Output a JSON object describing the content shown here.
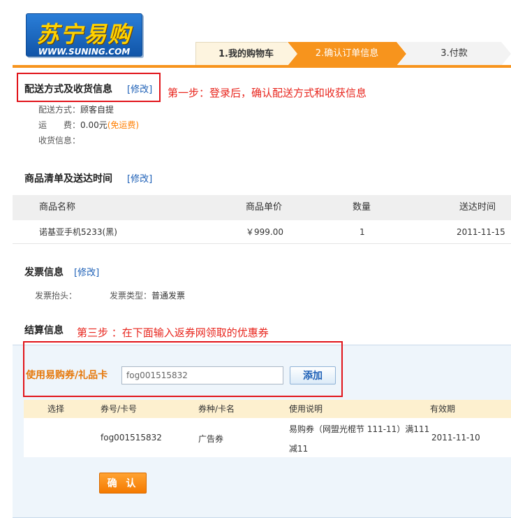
{
  "logo": {
    "brand": "苏宁易购",
    "url": "WWW.SUNING.COM"
  },
  "steps": [
    {
      "label": "1.我的购物车"
    },
    {
      "label": "2.确认订单信息"
    },
    {
      "label": "3.付款"
    }
  ],
  "delivery": {
    "title": "配送方式及收货信息",
    "edit": "[修改]",
    "annotation": "第一步：登录后，确认配送方式和收获信息",
    "method_label": "配送方式：",
    "method_value": "顾客自提",
    "fee_label": "运　　费：",
    "fee_value": "0.00元",
    "fee_note": "(免运费)",
    "address_label": "收货信息："
  },
  "goods": {
    "title": "商品清单及送达时间",
    "edit": "[修改]",
    "columns": [
      "商品名称",
      "商品单价",
      "数量",
      "送达时间"
    ],
    "rows": [
      {
        "name": "诺基亚手机5233(黑)",
        "price": "￥999.00",
        "qty": "1",
        "date": "2011-11-15"
      }
    ]
  },
  "invoice": {
    "title": "发票信息",
    "edit": "[修改]",
    "header_label": "发票抬头：",
    "type_label": "发票类型：",
    "type_value": "普通发票"
  },
  "settlement": {
    "title": "结算信息",
    "annotation": "第三步 ：在下面输入返券网领取的优惠券",
    "coupon_label": "使用易购券/礼品卡",
    "coupon_value": "fog001515832",
    "add_button": "添加",
    "columns": [
      "选择",
      "券号/卡号",
      "券种/卡名",
      "使用说明",
      "有效期"
    ],
    "rows": [
      {
        "code": "fog001515832",
        "kind": "广告券",
        "desc_line1": "易购券（网盟光棍节 111-11）满111",
        "desc_line2": "减11",
        "expiry": "2011-11-10"
      }
    ],
    "confirm_button": "确 认"
  }
}
